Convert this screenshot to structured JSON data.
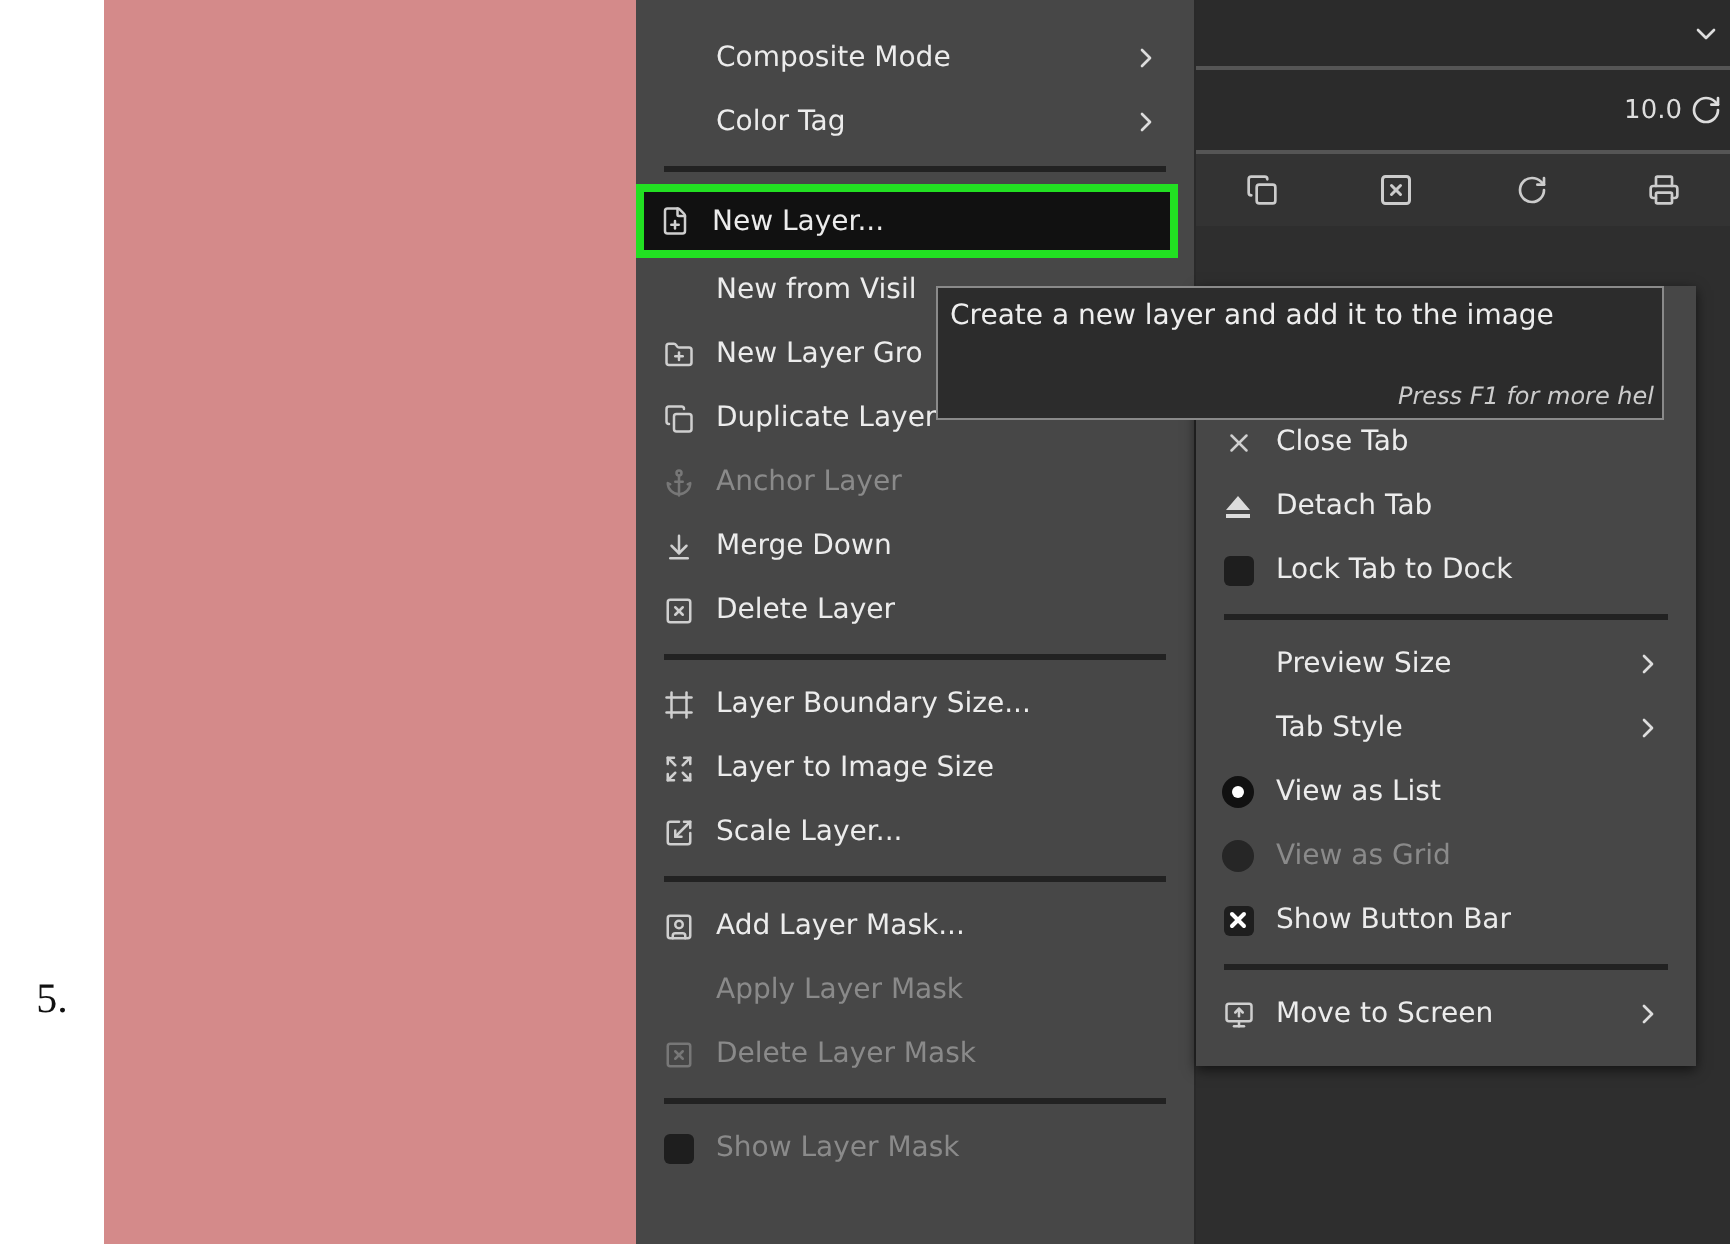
{
  "step_number": "5.",
  "layers_menu": {
    "items": [
      {
        "kind": "submenu",
        "label": "Composite Mode",
        "disabled": false,
        "highlighted": false
      },
      {
        "kind": "submenu",
        "label": "Color Tag",
        "disabled": false,
        "highlighted": false
      },
      {
        "kind": "separator"
      },
      {
        "kind": "action",
        "label": "New Layer...",
        "disabled": false,
        "highlighted": true
      },
      {
        "kind": "action",
        "label": "New from Visil",
        "disabled": false,
        "highlighted": false
      },
      {
        "kind": "action",
        "label": "New Layer Gro",
        "disabled": false,
        "highlighted": false
      },
      {
        "kind": "action",
        "label": "Duplicate Layer",
        "disabled": false,
        "highlighted": false
      },
      {
        "kind": "action",
        "label": "Anchor Layer",
        "disabled": true,
        "highlighted": false
      },
      {
        "kind": "action",
        "label": "Merge Down",
        "disabled": false,
        "highlighted": false
      },
      {
        "kind": "action",
        "label": "Delete Layer",
        "disabled": false,
        "highlighted": false
      },
      {
        "kind": "separator"
      },
      {
        "kind": "action",
        "label": "Layer Boundary Size...",
        "disabled": false,
        "highlighted": false
      },
      {
        "kind": "action",
        "label": "Layer to Image Size",
        "disabled": false,
        "highlighted": false
      },
      {
        "kind": "action",
        "label": "Scale Layer...",
        "disabled": false,
        "highlighted": false
      },
      {
        "kind": "separator"
      },
      {
        "kind": "action",
        "label": "Add Layer Mask...",
        "disabled": false,
        "highlighted": false
      },
      {
        "kind": "action",
        "label": "Apply Layer Mask",
        "disabled": true,
        "highlighted": false
      },
      {
        "kind": "action",
        "label": "Delete Layer Mask",
        "disabled": true,
        "highlighted": false
      },
      {
        "kind": "separator"
      },
      {
        "kind": "check",
        "label": "Show Layer Mask",
        "disabled": true,
        "checked": false
      }
    ]
  },
  "panel": {
    "opacity_value": "10.0"
  },
  "dock_menu": {
    "items": [
      {
        "kind": "action",
        "label": "Close Tab",
        "disabled": false
      },
      {
        "kind": "action",
        "label": "Detach Tab",
        "disabled": false
      },
      {
        "kind": "check",
        "label": "Lock Tab to Dock",
        "disabled": false,
        "checked": false
      },
      {
        "kind": "separator"
      },
      {
        "kind": "submenu",
        "label": "Preview Size",
        "disabled": false
      },
      {
        "kind": "submenu",
        "label": "Tab Style",
        "disabled": false
      },
      {
        "kind": "radio",
        "label": "View as List",
        "disabled": false,
        "selected": true
      },
      {
        "kind": "radio",
        "label": "View as Grid",
        "disabled": true,
        "selected": false
      },
      {
        "kind": "check",
        "label": "Show Button Bar",
        "disabled": false,
        "checked": true
      },
      {
        "kind": "separator"
      },
      {
        "kind": "submenu",
        "label": "Move to Screen",
        "disabled": false
      }
    ]
  },
  "tooltip": {
    "text": "Create a new layer and add it to the image",
    "hint": "Press F1 for more hel"
  }
}
